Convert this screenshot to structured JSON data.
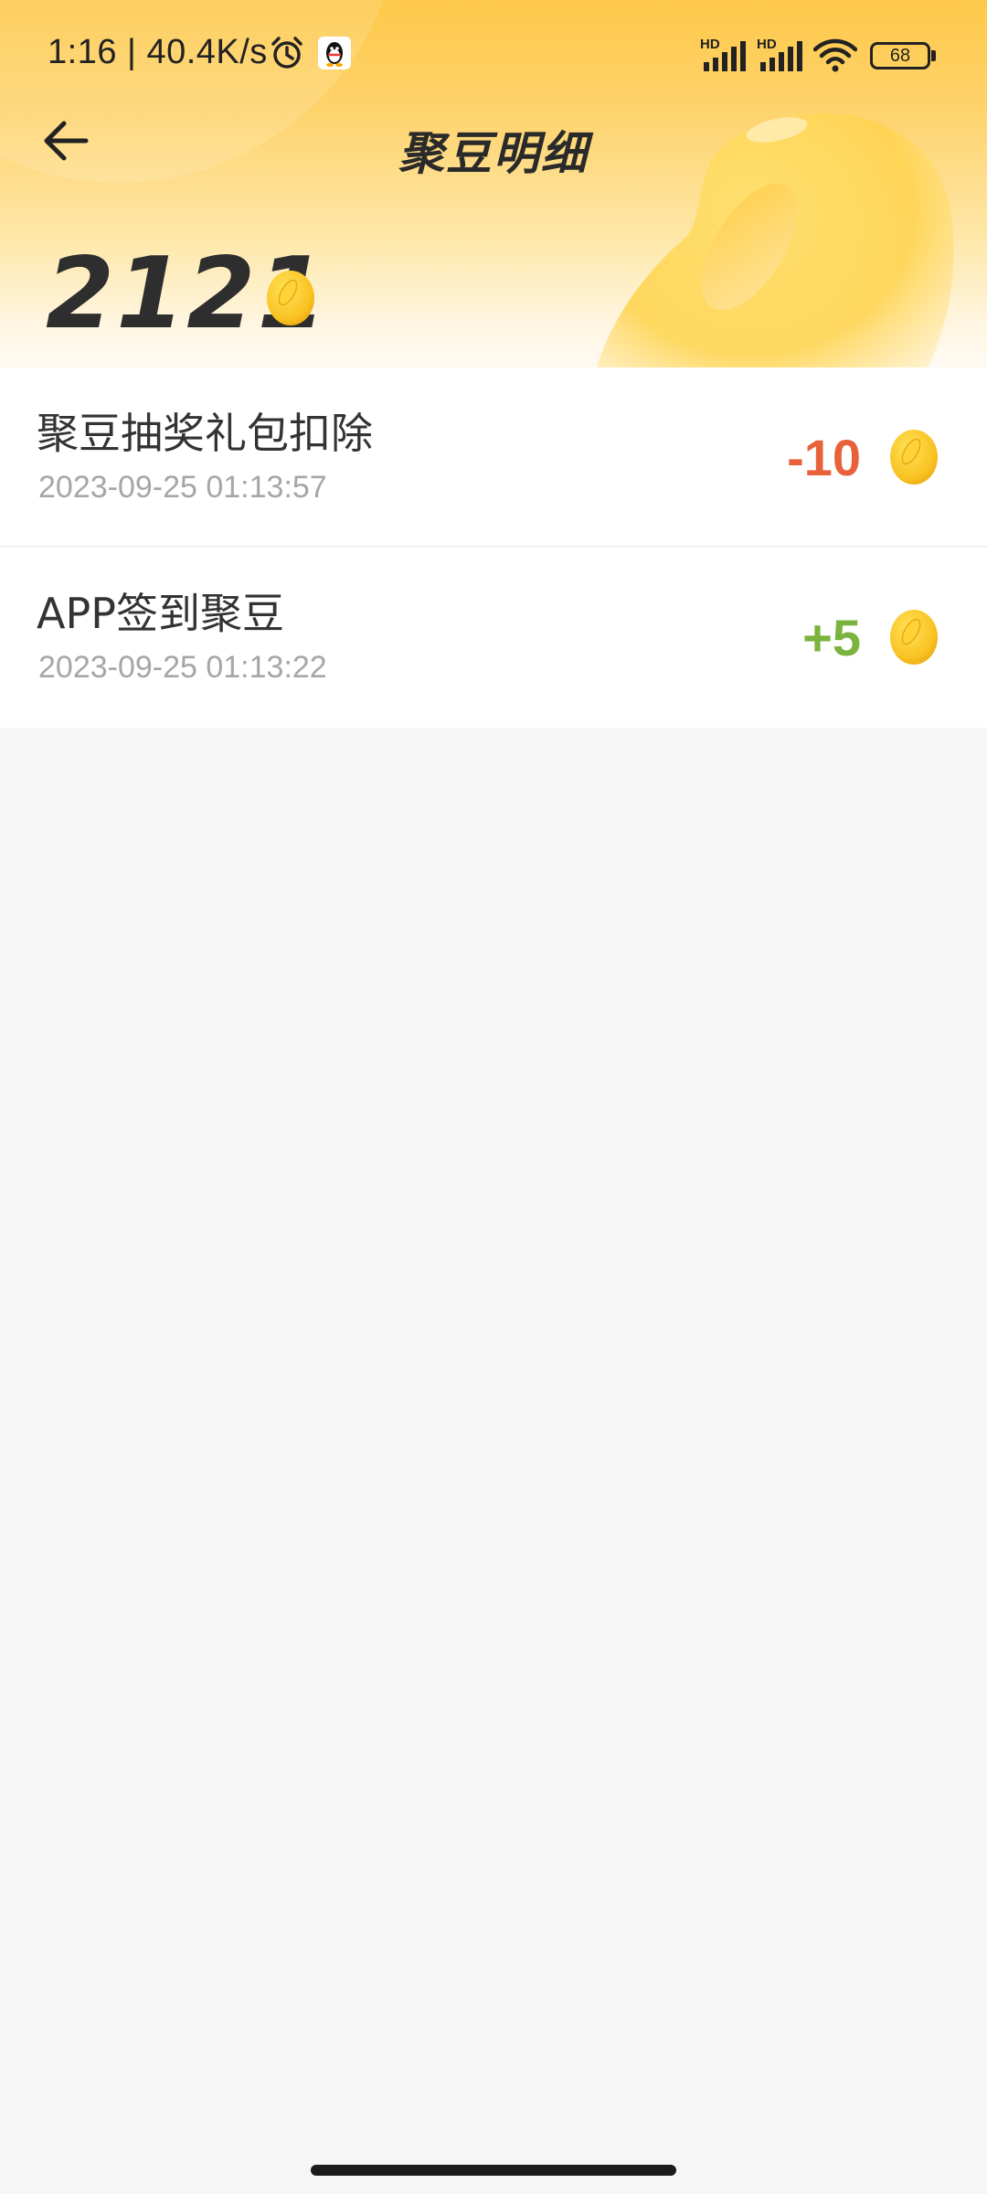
{
  "status_bar": {
    "time": "1:16 | 40.4K/s",
    "network_label_1": "HD",
    "network_label_2": "HD",
    "battery": "68"
  },
  "app_bar": {
    "title": "聚豆明细"
  },
  "balance": {
    "value": "2121"
  },
  "records": [
    {
      "title": "聚豆抽奖礼包扣除",
      "time": "2023-09-25 01:13:57",
      "amount": "-10",
      "color": "#e8613a"
    },
    {
      "title": "APP签到聚豆",
      "time": "2023-09-25 01:13:22",
      "amount": "+5",
      "color": "#7ab33d"
    }
  ],
  "colors": {
    "header_top": "#fec94a",
    "bean": "#f7b81c",
    "negative": "#e8613a",
    "positive": "#7ab33d"
  },
  "icons": {
    "back": "arrow-left-icon",
    "alarm": "alarm-clock-icon",
    "qq": "qq-penguin-icon",
    "signal": "cell-signal-icon",
    "wifi": "wifi-icon",
    "battery": "battery-icon",
    "bean": "bean-coin-icon"
  }
}
